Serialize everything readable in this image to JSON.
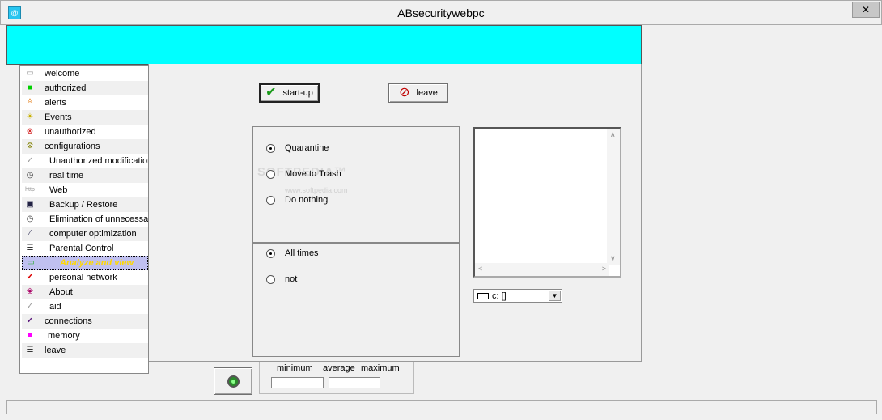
{
  "window": {
    "title": "ABsecuritywebpc",
    "close_glyph": "✕",
    "app_icon": "@"
  },
  "sidebar": {
    "items": [
      {
        "label": "welcome",
        "icon": "doc-icon"
      },
      {
        "label": "authorized",
        "icon": "green-square-icon"
      },
      {
        "label": "alerts",
        "icon": "alert-person-icon"
      },
      {
        "label": "Events",
        "icon": "lightbulb-icon"
      },
      {
        "label": "unauthorized",
        "icon": "no-entry-icon"
      },
      {
        "label": "configurations",
        "icon": "config-icon"
      },
      {
        "label": "Unauthorized modifications",
        "icon": "check-small-icon"
      },
      {
        "label": "real time",
        "icon": "clock-icon"
      },
      {
        "label": "Web",
        "icon": "http-icon"
      },
      {
        "label": "Backup / Restore",
        "icon": "floppy-icon"
      },
      {
        "label": "Elimination of unnecessary",
        "icon": "clock-icon"
      },
      {
        "label": "computer optimization",
        "icon": "wand-icon"
      },
      {
        "label": "Parental Control",
        "icon": "list-icon"
      },
      {
        "label": "Analyze and view",
        "icon": "monitor-icon"
      },
      {
        "label": "personal network",
        "icon": "red-check-icon"
      },
      {
        "label": "About",
        "icon": "about-icon"
      },
      {
        "label": "aid",
        "icon": "check-icon"
      },
      {
        "label": "connections",
        "icon": "purple-check-icon"
      },
      {
        "label": "memory",
        "icon": "magenta-square-icon"
      },
      {
        "label": "leave",
        "icon": "list-icon"
      }
    ]
  },
  "buttons": {
    "startup": "start-up",
    "leave": "leave"
  },
  "action_group": {
    "options": [
      "Quarantine",
      "Move to Trash",
      "Do nothing"
    ],
    "selected": "Quarantine"
  },
  "schedule_group": {
    "options": [
      "All times",
      "not"
    ],
    "selected": "All times"
  },
  "watermark": {
    "text": "SOFTPEDIA™",
    "url": "www.softpedia.com"
  },
  "drive": {
    "value": "c: []"
  },
  "stats": {
    "labels": [
      "minimum",
      "average",
      "maximum"
    ]
  },
  "colors": {
    "header_bar": "#00ffff",
    "highlight_text": "#ffd800"
  }
}
